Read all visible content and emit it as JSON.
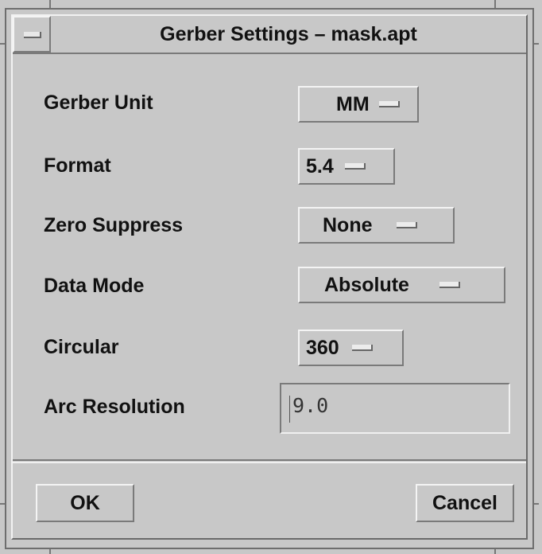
{
  "window": {
    "title": "Gerber Settings – mask.apt"
  },
  "fields": {
    "gerber_unit": {
      "label": "Gerber Unit",
      "value": "MM"
    },
    "format": {
      "label": "Format",
      "value": "5.4"
    },
    "zero_suppress": {
      "label": "Zero Suppress",
      "value": "None"
    },
    "data_mode": {
      "label": "Data Mode",
      "value": "Absolute"
    },
    "circular": {
      "label": "Circular",
      "value": "360"
    },
    "arc_resolution": {
      "label": "Arc Resolution",
      "value": "9.0"
    }
  },
  "buttons": {
    "ok": "OK",
    "cancel": "Cancel"
  },
  "icons": {
    "system_menu": "window-menu-icon",
    "option_indicator": "option-menu-indicator-icon"
  }
}
